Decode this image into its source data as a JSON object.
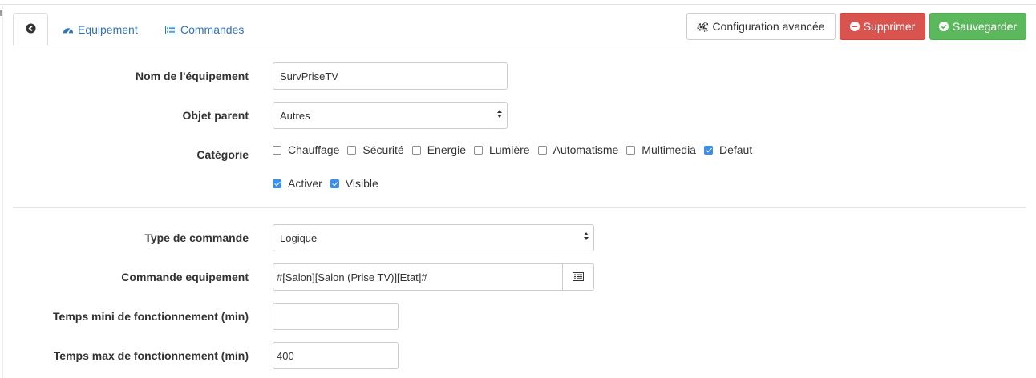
{
  "tabs": {
    "back_icon": "arrow-circle-left-icon",
    "equipement": {
      "label": "Equipement",
      "icon": "tachometer-icon"
    },
    "commandes": {
      "label": "Commandes",
      "icon": "list-alt-icon"
    }
  },
  "actions": {
    "config": {
      "label": "Configuration avancée",
      "icon": "cogs-icon"
    },
    "delete": {
      "label": "Supprimer",
      "icon": "minus-circle-icon",
      "color": "#d9534f"
    },
    "save": {
      "label": "Sauvegarder",
      "icon": "check-circle-icon",
      "color": "#5cb85c"
    }
  },
  "form": {
    "name": {
      "label": "Nom de l'équipement",
      "value": "SurvPriseTV"
    },
    "parent": {
      "label": "Objet parent",
      "value": "Autres"
    },
    "category": {
      "label": "Catégorie",
      "options": [
        {
          "label": "Chauffage",
          "checked": false
        },
        {
          "label": "Sécurité",
          "checked": false
        },
        {
          "label": "Energie",
          "checked": false
        },
        {
          "label": "Lumière",
          "checked": false
        },
        {
          "label": "Automatisme",
          "checked": false
        },
        {
          "label": "Multimedia",
          "checked": false
        },
        {
          "label": "Defaut",
          "checked": true
        }
      ]
    },
    "flags": [
      {
        "label": "Activer",
        "checked": true
      },
      {
        "label": "Visible",
        "checked": true
      }
    ],
    "command_type": {
      "label": "Type de commande",
      "value": "Logique"
    },
    "command_equipment": {
      "label": "Commande equipement",
      "value": "#[Salon][Salon (Prise TV)][Etat]#",
      "button_icon": "list-alt-icon"
    },
    "min_time": {
      "label": "Temps mini de fonctionnement (min)",
      "value": ""
    },
    "max_time": {
      "label": "Temps max de fonctionnement (min)",
      "value": "400"
    }
  },
  "colors": {
    "link": "#3273b5",
    "checkbox": "#3b8eea"
  }
}
